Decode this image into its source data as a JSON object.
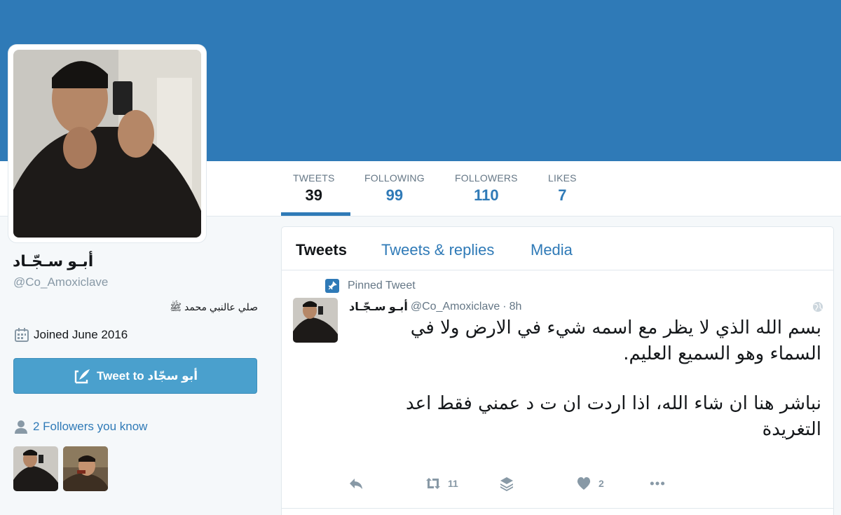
{
  "profile": {
    "name": "أبـو سـجّـاد",
    "handle": "@Co_Amoxiclave",
    "bio": "صلي عالنبي محمد ﷺ",
    "joined": "Joined June 2016",
    "tweet_to_button": "Tweet to أبو سجّاد"
  },
  "stats": [
    {
      "label": "TWEETS",
      "value": "39"
    },
    {
      "label": "FOLLOWING",
      "value": "99"
    },
    {
      "label": "FOLLOWERS",
      "value": "110"
    },
    {
      "label": "LIKES",
      "value": "7"
    }
  ],
  "followers_you_know": "2 Followers you know",
  "tabs": [
    "Tweets",
    "Tweets & replies",
    "Media"
  ],
  "tweet": {
    "pinned_label": "Pinned Tweet",
    "fullname": "أبـو سـجّـاد",
    "handle": "@Co_Amoxiclave",
    "dot": "·",
    "time": "8h",
    "text_line1": "بسم الله الذي لا يظر مع اسمه شيء في الارض ولا في السماء وهو السميع العليم.",
    "text_line2": "نباشر هنا ان شاء الله، اذا اردت ان ت د عمني فقط اعد التغريدة",
    "retweets": "11",
    "likes": "2"
  },
  "colors": {
    "brand": "#2f7ab7",
    "button": "#4aa0cd",
    "muted": "#8899a6"
  },
  "icons": [
    "calendar-icon",
    "quill-icon",
    "person-icon",
    "pin-icon",
    "globe-icon",
    "reply-icon",
    "retweet-icon",
    "layers-icon",
    "heart-icon",
    "more-icon"
  ]
}
